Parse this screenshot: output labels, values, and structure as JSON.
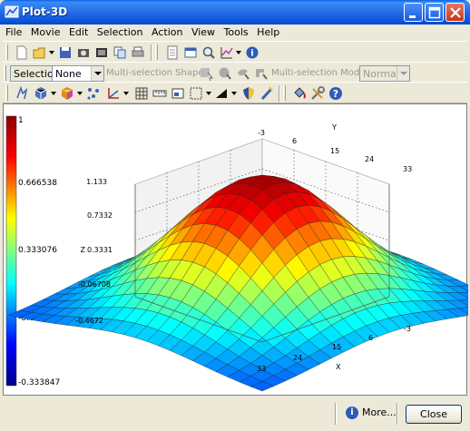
{
  "window": {
    "title": "Plot-3D"
  },
  "menu": [
    "File",
    "Movie",
    "Edit",
    "Selection",
    "Action",
    "View",
    "Tools",
    "Help"
  ],
  "selection_bar": {
    "label": "Selection",
    "value": "None",
    "multi_shape_label": "Multi-selection Shape",
    "multi_mode_label": "Multi-selection Mode",
    "mode_value": "Normal"
  },
  "colorbar": {
    "labels": [
      "1",
      "0.666538",
      "0.333076",
      "-0.000385287",
      "-0.333847"
    ],
    "colors": [
      "#8b0000",
      "#ff0000",
      "#ffff00",
      "#00ffff",
      "#0000ff",
      "#00008b"
    ]
  },
  "axes": {
    "z_label": "Z",
    "z_ticks": [
      "1.133",
      "0.7332",
      "0.3331",
      "-0.06708",
      "-0.4672"
    ],
    "y_label": "Y",
    "y_ticks": [
      "-3",
      "6",
      "15",
      "24",
      "33"
    ],
    "x_label": "X",
    "x_ticks": [
      "33",
      "24",
      "15",
      "6",
      "-3"
    ]
  },
  "status": {
    "more_label": "More...",
    "close_label": "Close"
  }
}
